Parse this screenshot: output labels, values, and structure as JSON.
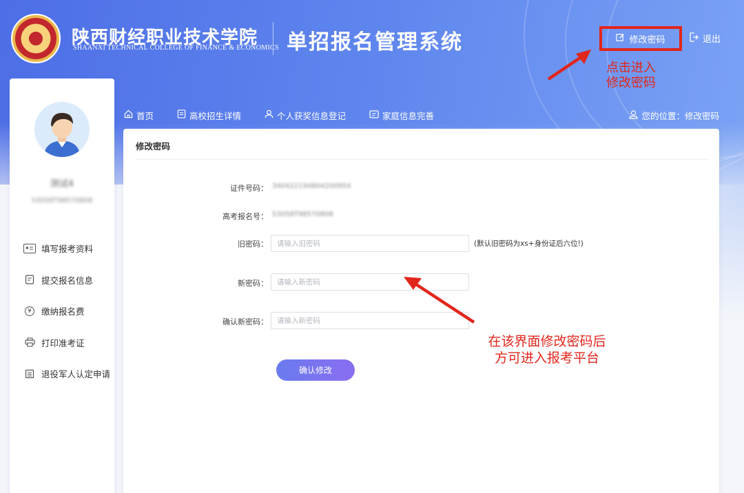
{
  "header": {
    "school_name_cn": "陕西财经职业技术学院",
    "school_name_en": "SHAANXI TECHNICAL COLLEGE OF FINANCE & ECONOMICS",
    "system_title": "单招报名管理系统",
    "change_password": "修改密码",
    "logout": "退出"
  },
  "annotations": {
    "top_hint_line1": "点击进入",
    "top_hint_line2": "修改密码",
    "form_hint_line1": "在该界面修改密码后",
    "form_hint_line2": "方可进入报考平台"
  },
  "nav": {
    "items": [
      {
        "label": "首页",
        "icon": "home-icon"
      },
      {
        "label": "高校招生详情",
        "icon": "document-icon"
      },
      {
        "label": "个人获奖信息登记",
        "icon": "user-icon"
      },
      {
        "label": "家庭信息完善",
        "icon": "id-card-icon"
      }
    ],
    "location_label": "您的位置：修改密码"
  },
  "sidebar": {
    "user_name": "测试4",
    "user_id": "53058T98570808",
    "items": [
      {
        "label": "填写报考资料",
        "icon": "id-card-icon"
      },
      {
        "label": "提交报名信息",
        "icon": "form-icon"
      },
      {
        "label": "缴纳报名费",
        "icon": "yuan-icon"
      },
      {
        "label": "打印准考证",
        "icon": "printer-icon"
      },
      {
        "label": "退役军人认定申请",
        "icon": "list-icon"
      }
    ]
  },
  "form": {
    "title": "修改密码",
    "id_label": "证件号码：",
    "id_value": "34042219480420095X",
    "exam_no_label": "高考报名号：",
    "exam_no_value": "53058T98570808",
    "old_pwd_label": "旧密码：",
    "old_pwd_placeholder": "请输入旧密码",
    "old_pwd_hint": "(默认旧密码为xs+身份证后六位!)",
    "new_pwd_label": "新密码：",
    "new_pwd_placeholder": "请输入新密码",
    "confirm_pwd_label": "确认新密码：",
    "confirm_pwd_placeholder": "请输入新密码",
    "submit_label": "确认修改"
  },
  "colors": {
    "header_blue": "#5f86ee",
    "annotation_red": "#e1261c",
    "button_gradient_start": "#6a7bef",
    "button_gradient_end": "#8a6df0"
  }
}
